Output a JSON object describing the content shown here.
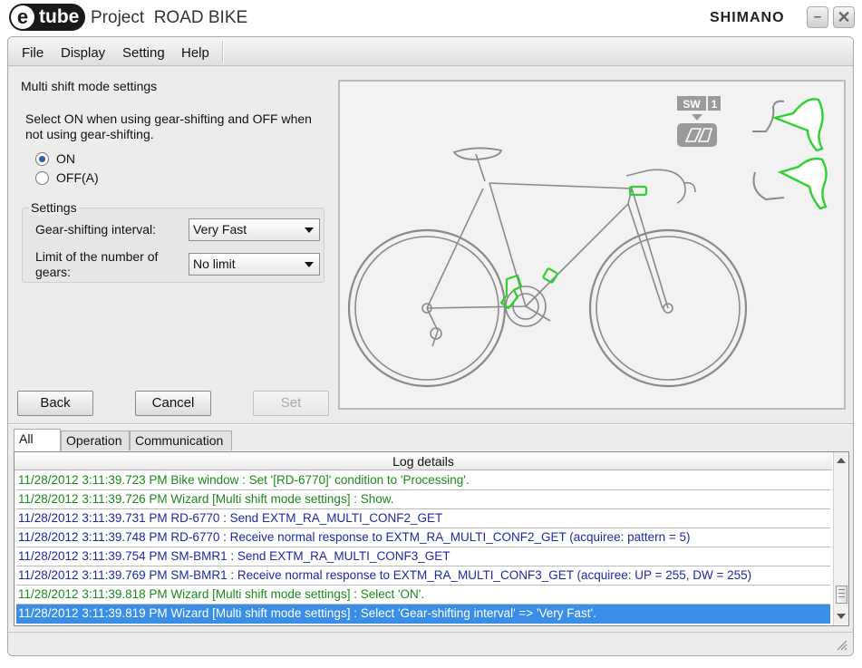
{
  "window": {
    "logo_letter": "e",
    "logo_text": "tube",
    "title": "Project  ROAD BIKE",
    "brand": "SHIMANO",
    "minimize_glyph": "–",
    "close_glyph": "✕"
  },
  "menu": {
    "items": [
      "File",
      "Display",
      "Setting",
      "Help"
    ]
  },
  "panel": {
    "title": "Multi shift mode settings",
    "description": "Select ON when using gear-shifting and OFF when not using gear-shifting.",
    "radio_on": "ON",
    "radio_off": "OFF(A)",
    "selected": "ON"
  },
  "settings": {
    "group_title": "Settings",
    "interval_label": "Gear-shifting interval:",
    "interval_value": "Very Fast",
    "limit_label": "Limit of the number of gears:",
    "limit_value": "No limit"
  },
  "buttons": {
    "back": "Back",
    "cancel": "Cancel",
    "set": "Set"
  },
  "diagram": {
    "sw_label": "SW",
    "sw_number": "1",
    "highlight_color": "#2fd12f"
  },
  "log": {
    "tabs": [
      "All",
      "Operation",
      "Communication"
    ],
    "active_tab": "All",
    "header": "Log details",
    "rows": [
      {
        "text": "11/28/2012 3:11:39.723 PM Bike window : Set '[RD-6770]' condition to 'Processing'.",
        "kind": "green"
      },
      {
        "text": "11/28/2012 3:11:39.726 PM Wizard [Multi shift mode settings] : Show.",
        "kind": "green"
      },
      {
        "text": "11/28/2012 3:11:39.731 PM RD-6770 : Send EXTM_RA_MULTI_CONF2_GET",
        "kind": "blue"
      },
      {
        "text": "11/28/2012 3:11:39.748 PM RD-6770 : Receive normal response to EXTM_RA_MULTI_CONF2_GET (acquiree: pattern = 5)",
        "kind": "blue"
      },
      {
        "text": "11/28/2012 3:11:39.754 PM SM-BMR1 : Send EXTM_RA_MULTI_CONF3_GET",
        "kind": "blue"
      },
      {
        "text": "11/28/2012 3:11:39.769 PM SM-BMR1 : Receive normal response to EXTM_RA_MULTI_CONF3_GET (acquiree: UP = 255, DW = 255)",
        "kind": "blue"
      },
      {
        "text": "11/28/2012 3:11:39.818 PM Wizard [Multi shift mode settings] : Select 'ON'.",
        "kind": "green"
      },
      {
        "text": "11/28/2012 3:11:39.819 PM Wizard [Multi shift mode settings] : Select 'Gear-shifting interval' => 'Very Fast'.",
        "kind": "selected"
      }
    ]
  },
  "colors": {
    "log_green": "#1a8a1a",
    "log_blue": "#1c2aa8",
    "selection": "#3a8ee6"
  }
}
